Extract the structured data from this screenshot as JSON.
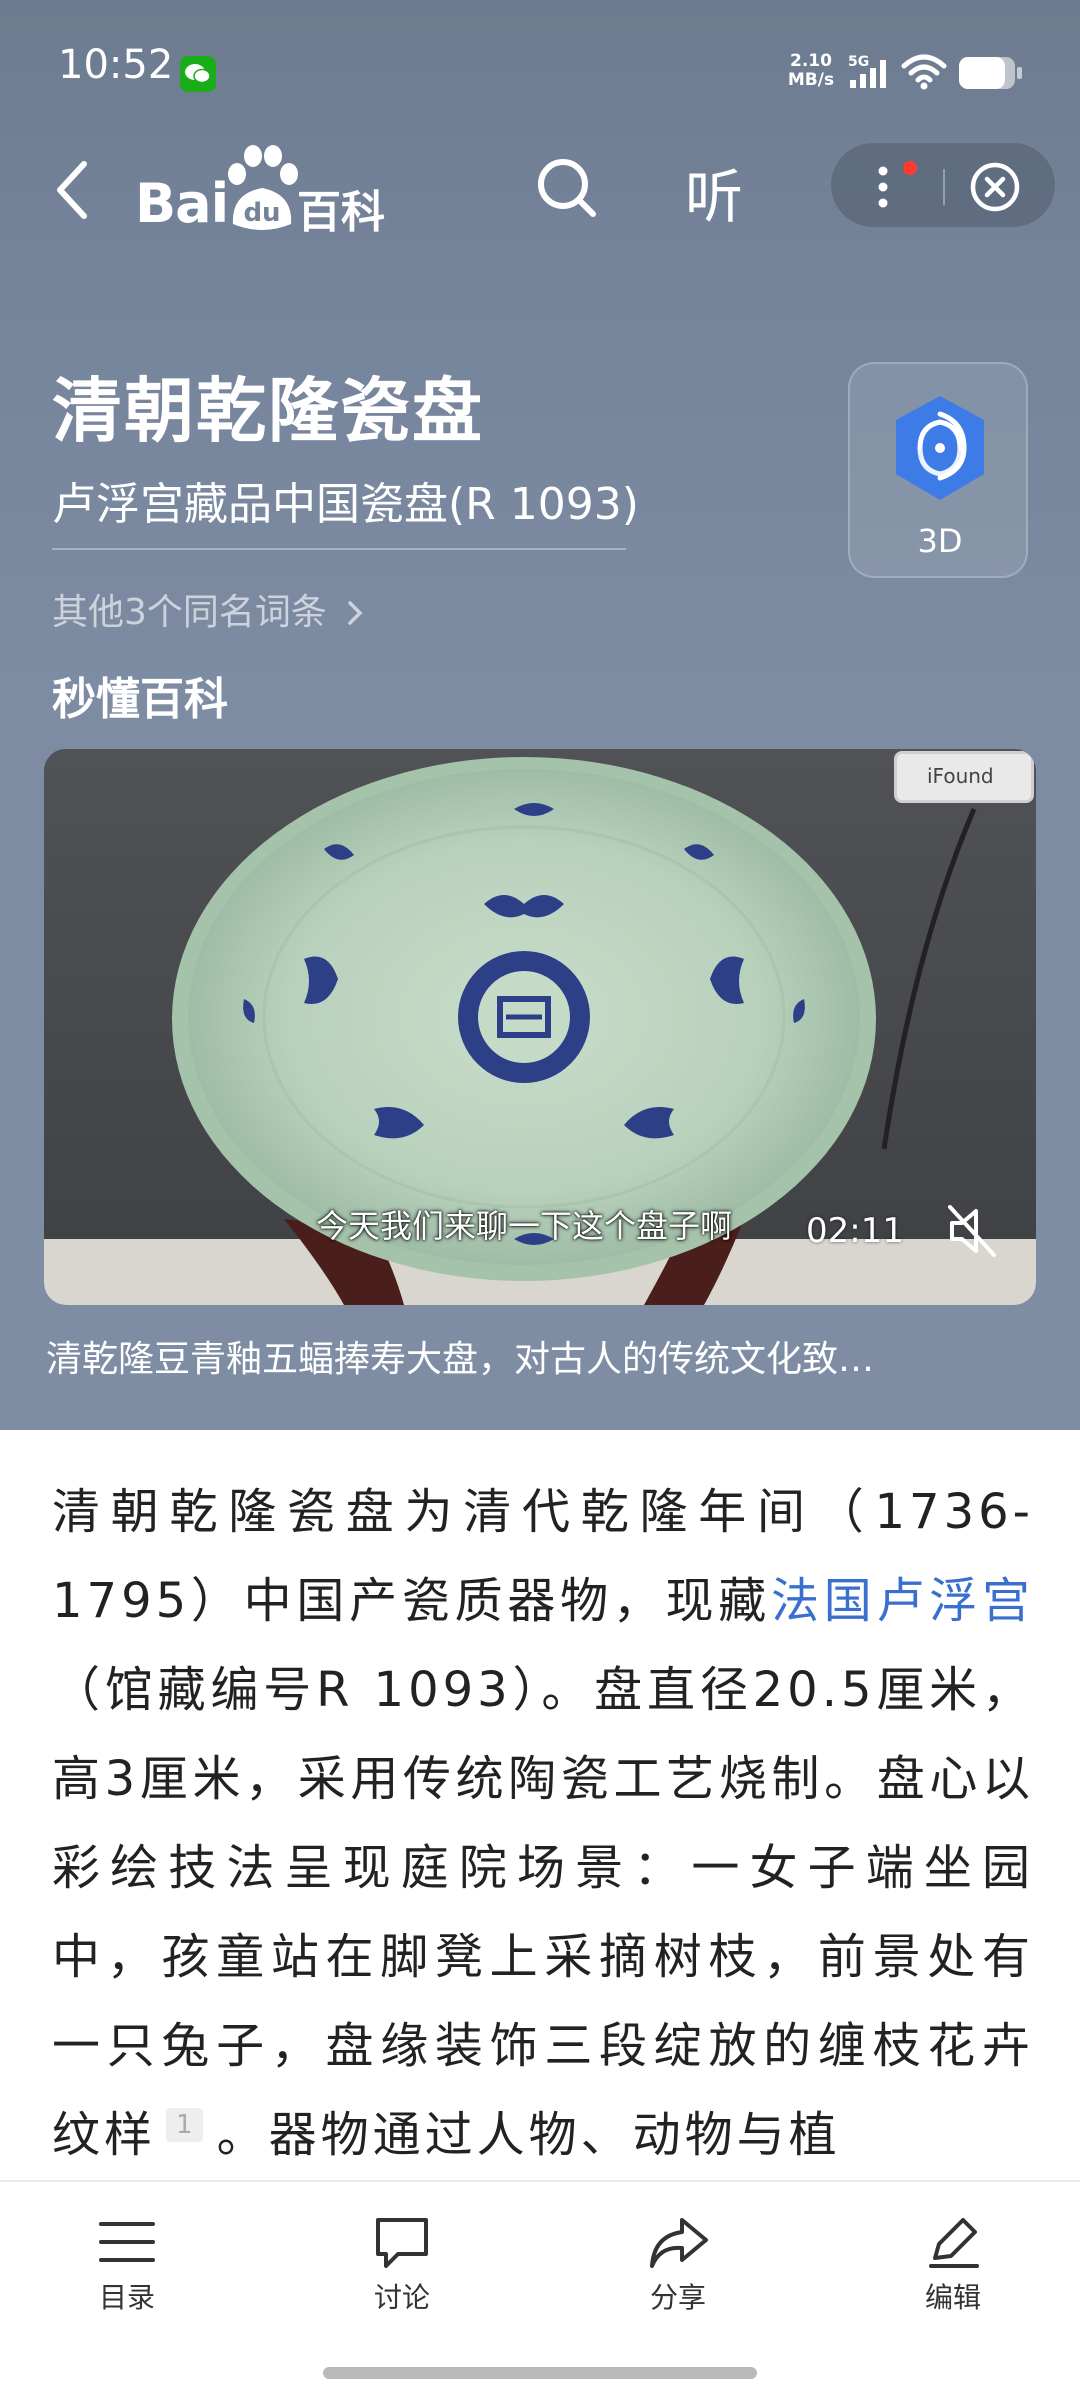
{
  "status_bar": {
    "time": "10:52",
    "net_speed_value": "2.10",
    "net_speed_unit": "MB/s",
    "network_type": "5G"
  },
  "nav": {
    "logo_latin": "Bai",
    "logo_paw_text": "du",
    "logo_chinese": "百科",
    "listen_label": "听"
  },
  "entry": {
    "title": "清朝乾隆瓷盘",
    "subtitle": "卢浮宫藏品中国瓷盘(R 1093)",
    "other_entries": "其他3个同名词条",
    "btn_3d_label": "3D"
  },
  "section": {
    "heading": "秒懂百科"
  },
  "video": {
    "subtitle": "今天我们来聊一下这个盘子啊",
    "duration": "02:11",
    "watermark": "iFound",
    "caption": "清乾隆豆青釉五蝠捧寿大盘，对古人的传统文化致…"
  },
  "article": {
    "text_part1": "清朝乾隆瓷盘为清代乾隆年间（1736-1795）中国产瓷质器物，现藏",
    "link": "法国卢浮宫",
    "text_part2": "（馆藏编号R 1093）。盘直径20.5厘米，高3厘米，采用传统陶瓷工艺烧制。盘心以彩绘技法呈现庭院场景：一女子端坐园中，孩童站在脚凳上采摘树枝，前景处有一只兔子，盘缘装饰三段绽放的缠枝花卉纹样",
    "ref": "1",
    "text_part3": "。器物通过人物、动物与植"
  },
  "bottom_tabs": [
    {
      "label": "目录",
      "icon": "list-icon"
    },
    {
      "label": "讨论",
      "icon": "chat-bubble-icon"
    },
    {
      "label": "分享",
      "icon": "share-icon"
    },
    {
      "label": "编辑",
      "icon": "pencil-icon"
    }
  ],
  "colors": {
    "header_bg": "#74839a",
    "link": "#3a6fd0",
    "accent_3d": "#3d7be6",
    "notification_dot": "#ff3b30"
  }
}
